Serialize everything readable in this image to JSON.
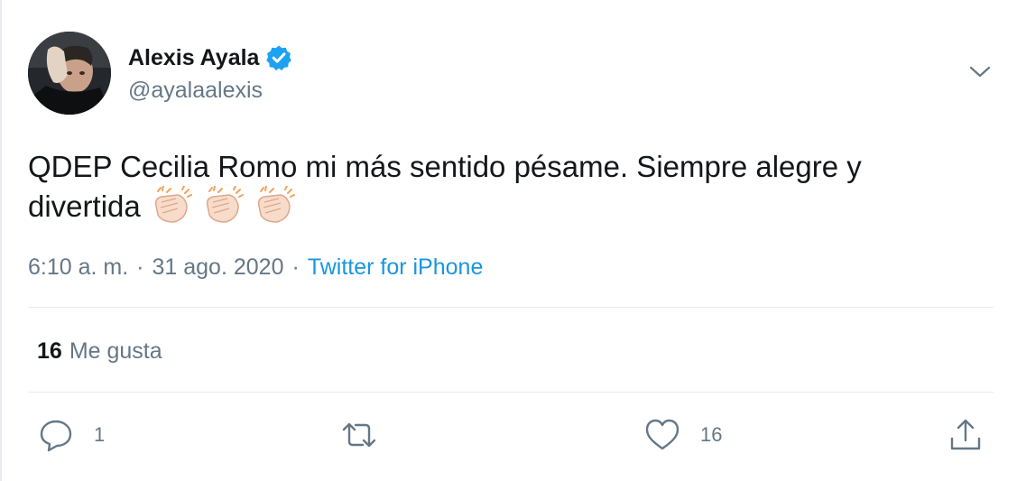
{
  "user": {
    "display_name": "Alexis Ayala",
    "handle": "@ayalaalexis",
    "verified": true,
    "verified_color": "#1da1f2"
  },
  "tweet": {
    "text": "QDEP Cecilia Romo mi más sentido pésame. Siempre alegre y divertida",
    "emoji": [
      "clapping-hands",
      "clapping-hands",
      "clapping-hands"
    ]
  },
  "meta": {
    "time": "6:10 a. m.",
    "date": "31 ago. 2020",
    "separator": "·",
    "source": "Twitter for iPhone",
    "source_color": "#1b95e0"
  },
  "stats": {
    "likes_count": "16",
    "likes_label": "Me gusta"
  },
  "actions": {
    "reply_count": "1",
    "retweet_count": "",
    "like_count": "16"
  },
  "icons": {
    "caret": "chevron-down-icon",
    "reply": "speech-bubble-icon",
    "retweet": "retweet-arrows-icon",
    "like": "heart-icon",
    "share": "share-upload-icon"
  }
}
